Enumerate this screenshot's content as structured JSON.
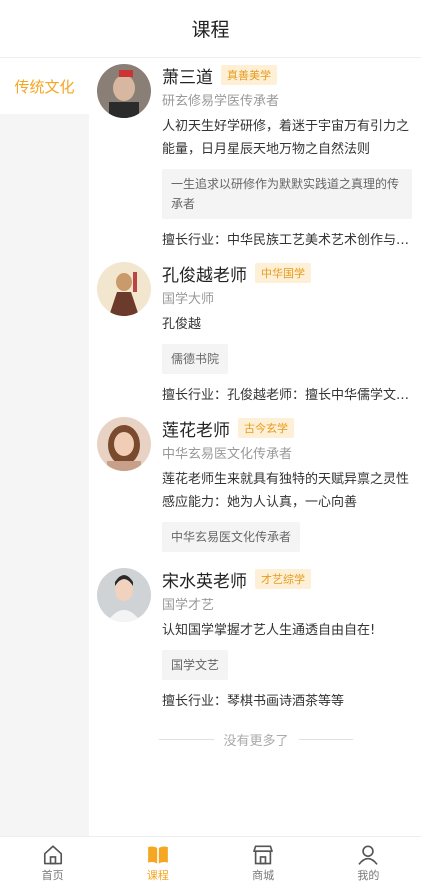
{
  "header": {
    "title": "课程"
  },
  "sidebar": {
    "items": [
      {
        "label": "传统文化"
      }
    ]
  },
  "teachers": [
    {
      "name": "萧三道",
      "tag": "真善美学",
      "subtitle": "研玄修易学医传承者",
      "desc": "人初天生好学研修，着迷于宇宙万有引力之能量，日月星辰天地万物之自然法则",
      "box": "一生追求以研修作为默默实践道之真理的传承者",
      "skill": "擅长行业：中华民族工艺美术艺术创作与传承"
    },
    {
      "name": "孔俊越老师",
      "tag": "中华国学",
      "subtitle": "国学大师",
      "desc": "孔俊越",
      "box": "儒德书院",
      "skill": "擅长行业：孔俊越老师：擅长中华儒学文化研究"
    },
    {
      "name": "莲花老师",
      "tag": "古今玄学",
      "subtitle": "中华玄易医文化传承者",
      "desc": "莲花老师生来就具有独特的天赋异禀之灵性感应能力：她为人认真，一心向善",
      "box": "中华玄易医文化传承者"
    },
    {
      "name": "宋水英老师",
      "tag": "才艺综学",
      "subtitle": "国学才艺",
      "desc": "认知国学掌握才艺人生通透自由自在!",
      "box": "国学文艺",
      "skill": "擅长行业：琴棋书画诗酒茶等等"
    }
  ],
  "list_end": "没有更多了",
  "tabbar": {
    "items": [
      {
        "label": "首页",
        "icon": "home-icon"
      },
      {
        "label": "课程",
        "icon": "book-icon"
      },
      {
        "label": "商城",
        "icon": "shop-icon"
      },
      {
        "label": "我的",
        "icon": "user-icon"
      }
    ]
  },
  "colors": {
    "accent": "#f5a623",
    "tag_bg": "#fdf0d6"
  }
}
